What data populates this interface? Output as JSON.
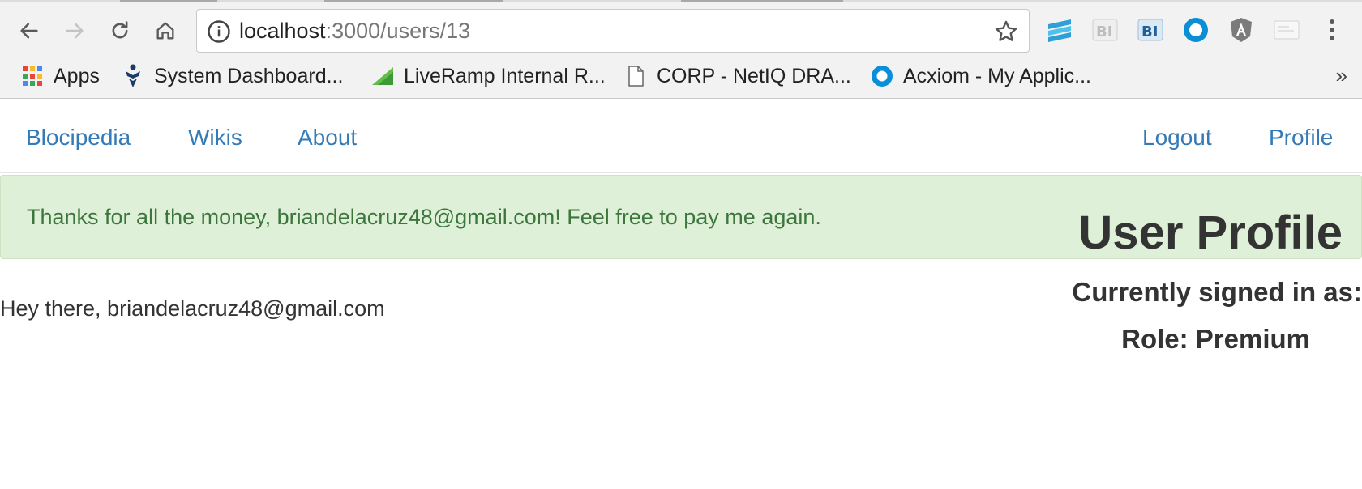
{
  "browser": {
    "url_host": "localhost",
    "url_path": ":3000/users/13",
    "nav_icons": [
      "back-arrow-icon",
      "forward-arrow-icon",
      "reload-icon",
      "home-icon"
    ],
    "extension_icons": [
      "stack-extension-icon",
      "bi-extension-icon",
      "bi-blue-extension-icon",
      "circle-extension-icon",
      "angular-extension-icon",
      "card-extension-icon",
      "menu-dots-icon"
    ],
    "bookmarks": [
      {
        "label": "Apps",
        "icon": "apps-grid-icon"
      },
      {
        "label": "System Dashboard...",
        "icon": "jira-icon"
      },
      {
        "label": "LiveRamp Internal R...",
        "icon": "liveramp-icon"
      },
      {
        "label": "CORP - NetIQ DRA...",
        "icon": "page-icon"
      },
      {
        "label": "Acxiom - My Applic...",
        "icon": "acxiom-icon"
      }
    ],
    "bookmarks_more": "»"
  },
  "nav": {
    "brand": "Blocipedia",
    "wikis": "Wikis",
    "about": "About",
    "logout": "Logout",
    "profile": "Profile"
  },
  "alert": {
    "message": "Thanks for all the money, briandelacruz48@gmail.com! Feel free to pay me again."
  },
  "profile": {
    "title": "User Profile",
    "signed_in_label": "Currently signed in as:",
    "role": "Role: Premium"
  },
  "greeting": "Hey there, briandelacruz48@gmail.com",
  "colors": {
    "link": "#337ab7",
    "alert_bg": "#dff0d8",
    "alert_text": "#3c763d",
    "text": "#333333"
  }
}
